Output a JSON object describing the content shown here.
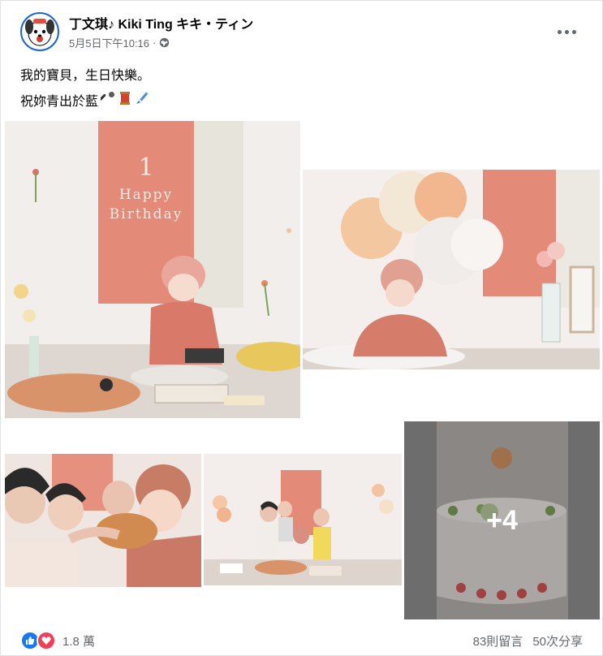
{
  "post": {
    "author": "丁文琪♪ Kiki Ting キキ・ティン",
    "timestamp": "5月5日下午10:16",
    "separator": "·",
    "caption_line1": "我的寶貝，生日快樂。",
    "caption_line2": "祝妳青出於藍",
    "caption_emojis": [
      "microphone-emoji",
      "thread-spool-emoji",
      "paintbrush-emoji"
    ]
  },
  "banner": {
    "number": "1",
    "line1": "Happy",
    "line2": "Birthday"
  },
  "gallery": {
    "more_count": "+4"
  },
  "footer": {
    "reactions_count": "1.8 萬",
    "comments": "83則留言",
    "shares": "50次分享"
  },
  "colors": {
    "accent": "#1877f2",
    "love": "#f33e58",
    "muted": "#65676b",
    "banner": "#e38a78"
  }
}
